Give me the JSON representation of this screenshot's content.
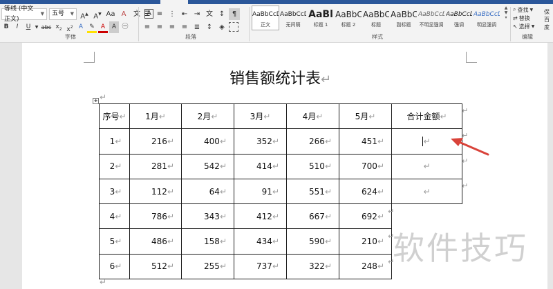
{
  "ribbon": {
    "font": {
      "font_name": "等线 (中文正文)",
      "font_size": "五号",
      "group_label": "字体"
    },
    "paragraph": {
      "group_label": "段落"
    },
    "styles": {
      "group_label": "样式",
      "items": [
        {
          "sample": "AaBbCcD",
          "name": "正文"
        },
        {
          "sample": "AaBbCcD",
          "name": "无间隔"
        },
        {
          "sample": "AaBl",
          "name": "标题 1"
        },
        {
          "sample": "AaBbC",
          "name": "标题 2"
        },
        {
          "sample": "AaBbC",
          "name": "标题"
        },
        {
          "sample": "AaBbC",
          "name": "副标题"
        },
        {
          "sample": "AaBbCcD",
          "name": "不明显强调"
        },
        {
          "sample": "AaBbCcD",
          "name": "强调"
        },
        {
          "sample": "AaBbCcD",
          "name": "明显强调"
        }
      ]
    },
    "editing": {
      "group_label": "编辑",
      "find_label": "查找",
      "replace_label": "替换",
      "select_label": "选择"
    },
    "right_cut": "保 百度"
  },
  "document": {
    "title": "销售额统计表",
    "para_mark": "↵",
    "table": {
      "headers": [
        "序号",
        "1月",
        "2月",
        "3月",
        "4月",
        "5月",
        "合计金额"
      ],
      "rows": [
        [
          "1",
          "216",
          "400",
          "352",
          "266",
          "451"
        ],
        [
          "2",
          "281",
          "542",
          "414",
          "510",
          "700"
        ],
        [
          "3",
          "112",
          "64",
          "91",
          "551",
          "624"
        ],
        [
          "4",
          "786",
          "343",
          "412",
          "667",
          "692"
        ],
        [
          "5",
          "486",
          "158",
          "434",
          "590",
          "210"
        ],
        [
          "6",
          "512",
          "255",
          "737",
          "322",
          "248"
        ]
      ]
    }
  },
  "watermark": "软件技巧",
  "colors": {
    "ribbon_bg": "#f3f3f3",
    "title_bar": "#2b579a",
    "arrow": "#d9433a"
  }
}
